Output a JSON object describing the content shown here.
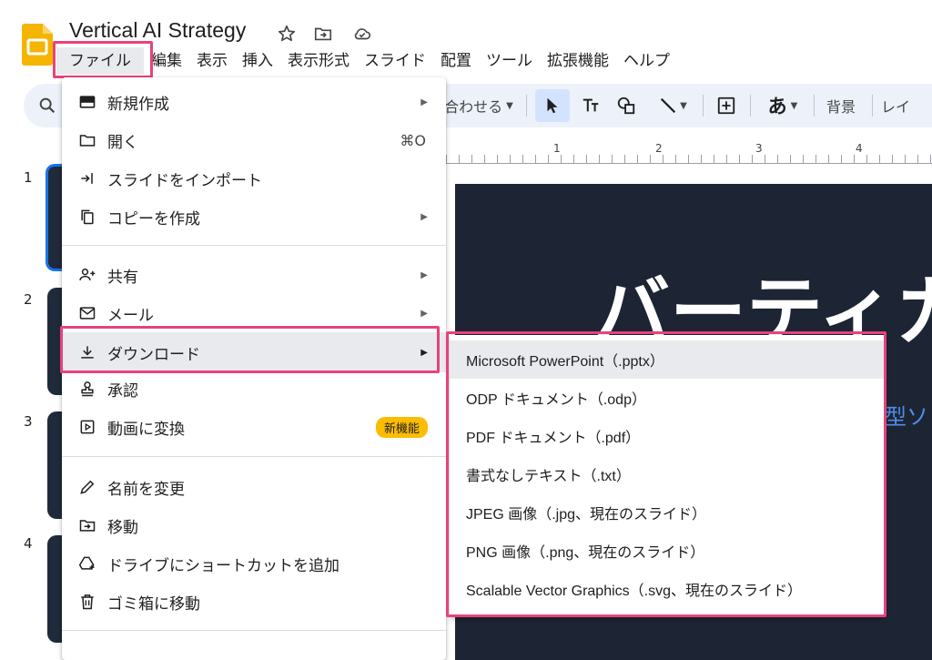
{
  "document": {
    "title": "Vertical AI Strategy",
    "star_icon": "star-icon",
    "move_icon": "folder-move-icon",
    "cloud_icon": "cloud-saved-icon"
  },
  "menubar": [
    {
      "label": "ファイル",
      "active": true
    },
    {
      "label": "編集"
    },
    {
      "label": "表示"
    },
    {
      "label": "挿入"
    },
    {
      "label": "表示形式"
    },
    {
      "label": "スライド"
    },
    {
      "label": "配置"
    },
    {
      "label": "ツール"
    },
    {
      "label": "拡張機能"
    },
    {
      "label": "ヘルプ"
    }
  ],
  "toolbar": {
    "fit_label": "合わせる",
    "font_label": "あ",
    "background_label": "背景",
    "layout_label": "レイ"
  },
  "ruler": {
    "numbers": [
      "1",
      "2",
      "3",
      "4"
    ]
  },
  "slides_panel": {
    "numbers": [
      "1",
      "2",
      "3",
      "4"
    ]
  },
  "slide": {
    "title": "バーティカ",
    "subtitle": "型ソ"
  },
  "file_menu": {
    "items": [
      {
        "label": "新規作成",
        "icon": "slides-icon",
        "arrow": true
      },
      {
        "label": "開く",
        "icon": "folder-icon",
        "shortcut": "⌘O"
      },
      {
        "label": "スライドをインポート",
        "icon": "import-icon"
      },
      {
        "label": "コピーを作成",
        "icon": "copy-icon",
        "arrow": true
      },
      {
        "label": "共有",
        "icon": "person-add-icon",
        "arrow": true
      },
      {
        "label": "メール",
        "icon": "mail-icon",
        "arrow": true
      },
      {
        "label": "ダウンロード",
        "icon": "download-icon",
        "arrow": true
      },
      {
        "label": "承認",
        "icon": "approval-icon"
      },
      {
        "label": "動画に変換",
        "icon": "video-icon",
        "badge": "新機能"
      },
      {
        "label": "名前を変更",
        "icon": "pencil-icon"
      },
      {
        "label": "移動",
        "icon": "folder-move-icon"
      },
      {
        "label": "ドライブにショートカットを追加",
        "icon": "drive-shortcut-icon"
      },
      {
        "label": "ゴミ箱に移動",
        "icon": "trash-icon"
      }
    ]
  },
  "download_submenu": {
    "items": [
      {
        "label": "Microsoft PowerPoint（.pptx）"
      },
      {
        "label": "ODP ドキュメント（.odp）"
      },
      {
        "label": "PDF ドキュメント（.pdf）"
      },
      {
        "label": "書式なしテキスト（.txt）"
      },
      {
        "label": "JPEG 画像（.jpg、現在のスライド）"
      },
      {
        "label": "PNG 画像（.png、現在のスライド）"
      },
      {
        "label": "Scalable Vector Graphics（.svg、現在のスライド）"
      }
    ]
  },
  "colors": {
    "highlight": "#e8427c",
    "badge": "#fbbc04",
    "logo": "#f4b400",
    "slide_bg": "#1d2433",
    "accent_blue": "#1a73e8"
  }
}
